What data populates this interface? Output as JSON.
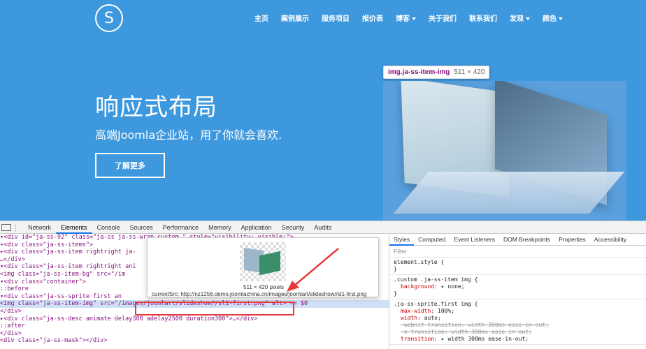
{
  "site": {
    "logo_letter": "S",
    "nav": [
      {
        "label": "主页",
        "dropdown": false
      },
      {
        "label": "案例展示",
        "dropdown": false
      },
      {
        "label": "服务项目",
        "dropdown": false
      },
      {
        "label": "报价表",
        "dropdown": false
      },
      {
        "label": "博客",
        "dropdown": true
      },
      {
        "label": "关于我们",
        "dropdown": false
      },
      {
        "label": "联系我们",
        "dropdown": false
      },
      {
        "label": "发现",
        "dropdown": true
      },
      {
        "label": "颜色",
        "dropdown": true
      }
    ],
    "hero_title": "响应式布局",
    "hero_subtitle": "高端Joomla企业站，用了你就会喜欢.",
    "hero_button": "了解更多",
    "highlight_tooltip": {
      "selector": "img.ja-ss-item-img",
      "dims": "511 × 420"
    },
    "colors": {
      "background": "#3e98dd",
      "highlight": "#6fa8dc"
    }
  },
  "devtools": {
    "tabs": [
      "Network",
      "Elements",
      "Console",
      "Sources",
      "Performance",
      "Memory",
      "Application",
      "Security",
      "Audits"
    ],
    "active_tab": "Elements",
    "elements_lines": [
      {
        "id": "l1",
        "text": "▾<div id=\"ja-ss-92\" class=\"ja-ss ja-ss-wrap custom \" style=\"visibility: visible;\">"
      },
      {
        "id": "l2",
        "text": "  ▾<div class=\"ja-ss-items\">"
      },
      {
        "id": "l3",
        "text": "    ▸<div class=\"ja-ss-item rightright ja-"
      },
      {
        "id": "l4",
        "text": "    …</div>"
      },
      {
        "id": "l5",
        "text": "    ▾<div class=\"ja-ss-item rightright ani"
      },
      {
        "id": "l6",
        "text": "       <img class=\"ja-ss-item-bg\" src=\"/im"
      },
      {
        "id": "l7",
        "text": "      ▾<div class=\"container\">"
      },
      {
        "id": "l8",
        "text": "         ::before"
      },
      {
        "id": "l9",
        "text": "        ▾<div class=\"ja-ss-sprite first an"
      },
      {
        "id": "l10",
        "text": "           <img class=\"ja-ss-item-img\" src=\"/images/joomlart/slideshow//sl1-first.png\" alt> == $0"
      },
      {
        "id": "l11",
        "text": "         </div>"
      },
      {
        "id": "l12",
        "text": "        ▸<div class=\"ja-ss-desc animate delay300 adelay2500 duration300\">…</div>"
      },
      {
        "id": "l13",
        "text": "         ::after"
      },
      {
        "id": "l14",
        "text": "       </div>"
      },
      {
        "id": "l15",
        "text": "       <div class=\"ja-ss-mask\"></div>"
      }
    ],
    "image_popup": {
      "size_text": "511 × 420 pixels",
      "current_src": "currentSrc: http://nz1256.demo.joomlachina.cn/images/joomlart/slideshow//sl1-first.png"
    },
    "styles_tabs": [
      "Styles",
      "Computed",
      "Event Listeners",
      "DOM Breakpoints",
      "Properties",
      "Accessibility"
    ],
    "active_styles_tab": "Styles",
    "filter_placeholder": "Filter",
    "rules": [
      {
        "selector": "element.style {",
        "props": [],
        "close": "}"
      },
      {
        "selector": ".custom .ja-ss-item img {",
        "props": [
          {
            "name": "background",
            "value": "▸ none;",
            "struck": false
          }
        ],
        "close": "}"
      },
      {
        "selector": ".ja-ss-sprite.first img {",
        "props": [
          {
            "name": "max-width",
            "value": "100%;",
            "struck": false
          },
          {
            "name": "width",
            "value": "auto;",
            "struck": false
          },
          {
            "name": "-webkit-transition",
            "value": "width 300ms ease-in-out;",
            "struck": true
          },
          {
            "name": "-o-transition",
            "value": "width 300ms ease-in-out;",
            "struck": true
          },
          {
            "name": "transition",
            "value": "▸ width 300ms ease-in-out;",
            "struck": false
          }
        ],
        "close": "}"
      }
    ]
  }
}
